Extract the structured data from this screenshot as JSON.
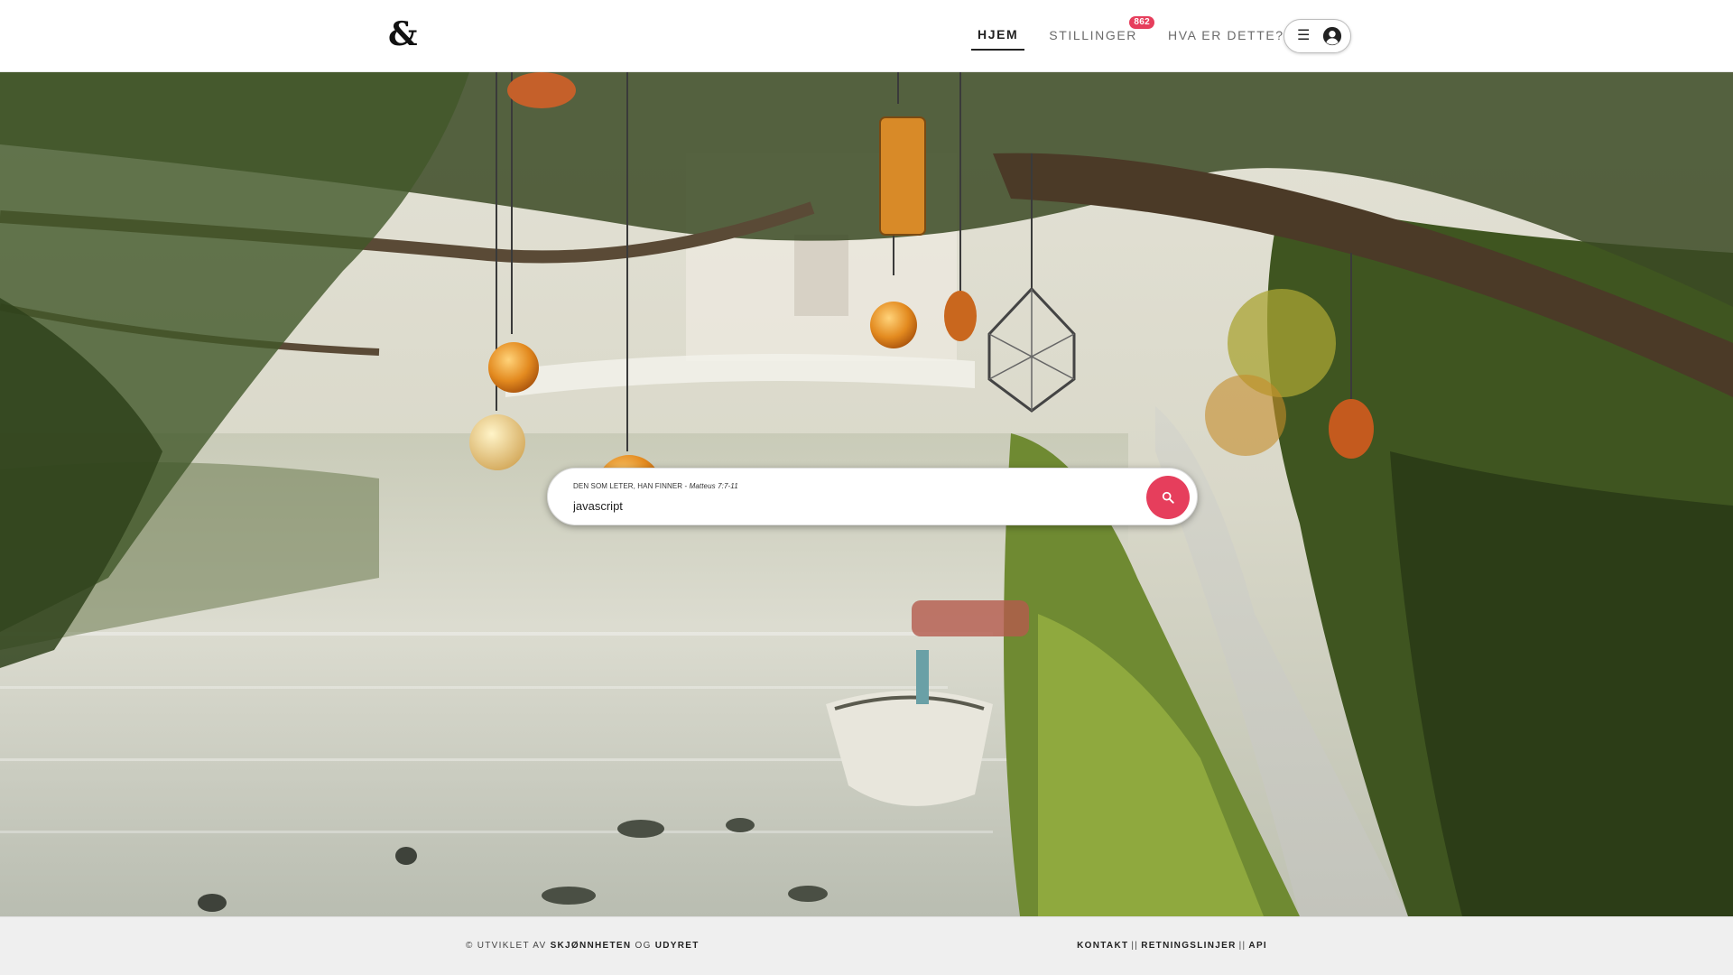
{
  "header": {
    "logo": "&",
    "nav": [
      {
        "label": "HJEM",
        "active": true
      },
      {
        "label": "STILLINGER",
        "badge": "862"
      },
      {
        "label": "HVA ER DETTE?"
      }
    ],
    "menu_icon": "hamburger-icon",
    "avatar_icon": "user-circle-icon"
  },
  "search": {
    "label": "DEN SOM LETER, HAN FINNER - ",
    "verse": "Matteus 7:7-11",
    "value": "javascript",
    "button_icon": "search-icon"
  },
  "footer": {
    "prefix": "© UTVIKLET AV ",
    "author1": "SKJØNNHETEN",
    "joiner": " OG ",
    "author2": "UDYRET",
    "links": [
      "KONTAKT",
      "RETNINGSLINJER",
      "API"
    ],
    "separator": "||"
  },
  "colors": {
    "accent": "#e63e5c",
    "footer_bg": "#efefef"
  }
}
